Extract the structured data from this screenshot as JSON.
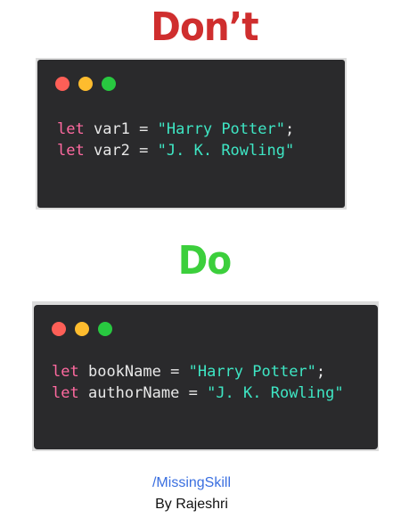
{
  "dont_heading": "Don’t",
  "do_heading": "Do",
  "colors": {
    "dont": "#cf2e2e",
    "do": "#3ccf3c",
    "card_bg": "#2a2a2c",
    "keyword": "#ff6aa0",
    "string": "#3ee6c4",
    "dot_red": "#fe5f57",
    "dot_yellow": "#febc2e",
    "dot_green": "#28c840",
    "brand": "#3a6fe0"
  },
  "bad_example": {
    "lines": [
      {
        "keyword": "let",
        "name": "var1",
        "op": "=",
        "value": "\"Harry Potter\"",
        "end": ";"
      },
      {
        "keyword": "let",
        "name": "var2",
        "op": "=",
        "value": "\"J. K. Rowling\"",
        "end": ""
      }
    ]
  },
  "good_example": {
    "lines": [
      {
        "keyword": "let",
        "name": "bookName",
        "op": "=",
        "value": "\"Harry Potter\"",
        "end": ";"
      },
      {
        "keyword": "let",
        "name": "authorName",
        "op": "=",
        "value": "\"J. K. Rowling\"",
        "end": ""
      }
    ]
  },
  "footer": {
    "brand": "/MissingSkill",
    "author": "By Rajeshri"
  }
}
